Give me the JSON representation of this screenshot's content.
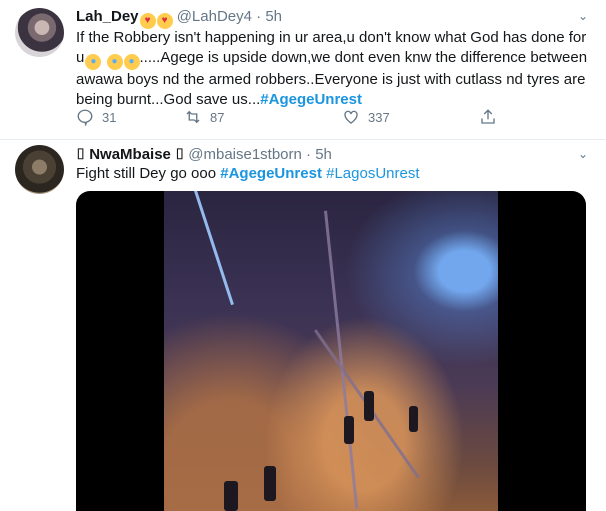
{
  "tweets": [
    {
      "name": "Lah_Dey",
      "handle": "@LahDey4",
      "time": "5h",
      "text_part1": "If the Robbery isn't happening in ur area,u don't know what God has done for u",
      "text_part2": ".....Agege is upside down,we dont even knw the difference between awawa boys nd the armed robbers..Everyone is just with cutlass nd tyres are being burnt...God save us...",
      "hashtag": "#AgegeUnrest",
      "replies": "31",
      "retweets": "87",
      "likes": "337"
    },
    {
      "name_prefix": "⌷",
      "name": "NwaMbaise",
      "name_suffix": "⌷",
      "handle": "@mbaise1stborn",
      "time": "5h",
      "text": "Fight still Dey go ooo",
      "hashtag1": "#AgegeUnrest",
      "hashtag2": "#LagosUnrest"
    }
  ],
  "separator": "·"
}
